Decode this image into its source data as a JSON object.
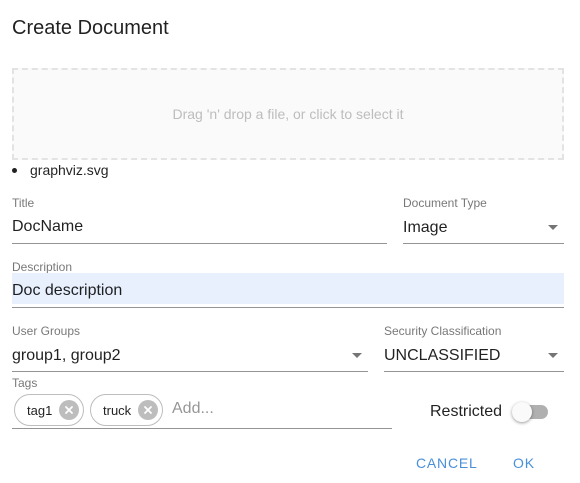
{
  "dialog": {
    "title": "Create Document"
  },
  "dropzone": {
    "text": "Drag 'n' drop a file, or click to select it"
  },
  "files": [
    {
      "name": "graphviz.svg"
    }
  ],
  "title_field": {
    "label": "Title",
    "value": "DocName"
  },
  "doc_type_field": {
    "label": "Document Type",
    "value": "Image"
  },
  "description_field": {
    "label": "Description",
    "value": "Doc description"
  },
  "user_groups_field": {
    "label": "User Groups",
    "value": "group1, group2"
  },
  "security_field": {
    "label": "Security Classification",
    "value": "UNCLASSIFIED"
  },
  "tags_field": {
    "label": "Tags",
    "chips": [
      {
        "label": "tag1"
      },
      {
        "label": "truck"
      }
    ],
    "placeholder": "Add..."
  },
  "restricted": {
    "label": "Restricted",
    "checked": false
  },
  "actions": {
    "cancel_label": "CANCEL",
    "ok_label": "OK"
  },
  "colors": {
    "accent": "#4a90d9",
    "autofill_bg": "#e8f0fe"
  }
}
